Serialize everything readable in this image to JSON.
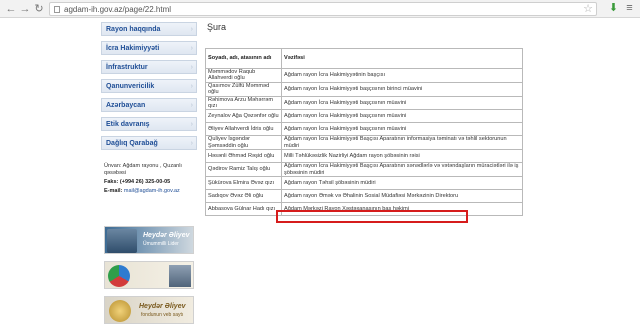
{
  "browser": {
    "url": "agdam-ih.gov.az/page/22.html"
  },
  "sidebar": {
    "items": [
      {
        "label": "Rayon haqqında"
      },
      {
        "label": "İcra Hakimiyyəti"
      },
      {
        "label": "İnfrastruktur"
      },
      {
        "label": "Qanunvericilik"
      },
      {
        "label": "Azərbaycan"
      },
      {
        "label": "Etik davranış"
      },
      {
        "label": "Dağlıq Qarabağ"
      }
    ]
  },
  "contact": {
    "address": "Ünvan: Ağdam rayonu , Quzanlı qəsəbəsi",
    "fax": "Faks: (+994 26) 325-00-05",
    "email_label": "E-mail:",
    "email": "mail@agdam-ih.gov.az"
  },
  "banners": {
    "b1_title": "Heydər Əliyev",
    "b1_sub": "Ümummilli Lider",
    "b3_title": "Heydər Əliyev",
    "b3_sub": "fondunun veb saytı"
  },
  "main": {
    "title": "Şura",
    "table": {
      "headers": [
        "Soyadı, adı, atasının adı",
        "Vəzifəsi"
      ],
      "rows": [
        {
          "name": "Məmmədov Raqub Allahverdi oğlu",
          "position": "Ağdam rayon İcra Hakimiyyətinin başçısı"
        },
        {
          "name": "Qasımov Zülfü Məmməd oğlu",
          "position": "Ağdam rayon İcra Hakimiyyəti başçısının birinci müavini"
        },
        {
          "name": "Rəhimova Arzu Məhərrəm qızı",
          "position": "Ağdam rayon İcra Hakimiyyəti başçısının müavini"
        },
        {
          "name": "Zeynalov Ağa Qəzənfər oğlu",
          "position": "Ağdam rayon İcra Hakimiyyəti başçısının müavini"
        },
        {
          "name": "Əliyev Allahverdi İdris oğlu",
          "position": "Ağdam rayon İcra Hakimiyyəti başçısının müavini"
        },
        {
          "name": "Quliyev İsgəndər Şəmsəddin oğlu",
          "position": "Ağdam rayon İcra Hakimiyyəti Başçısı Aparatının informasiya təminatı və təhlil sektorunun müdiri"
        },
        {
          "name": "Həsənli Əhməd Rəşid oğlu",
          "position": "Milli Təhlükəsizlik Nazirliyi Ağdam rayon şöbəsinin rəisi"
        },
        {
          "name": "Qədirov Ramiz Talış oğlu",
          "position": "Ağdam rayon İcra Hakimiyyəti Başçısı Aparatının sənədlərlə və vətəndaşların müraciətləri ilə iş şöbəsinin müdiri"
        },
        {
          "name": "Şükürova Elmira Əvəz qızı",
          "position": "Ağdam rayon Təhsil şöbəsinin müdiri"
        },
        {
          "name": "Sadıqov Əvəz Əli oğlu",
          "position": "Ağdam rayon Əmək və Əhalinin Sosial Müdafiəsi Mərkəzinin Direktoru"
        },
        {
          "name": "Abbasova Gülnar Hadı qızı",
          "position": "Ağdam Mərkəzi Rayon Xəstəxanasının baş həkimi"
        }
      ]
    }
  }
}
